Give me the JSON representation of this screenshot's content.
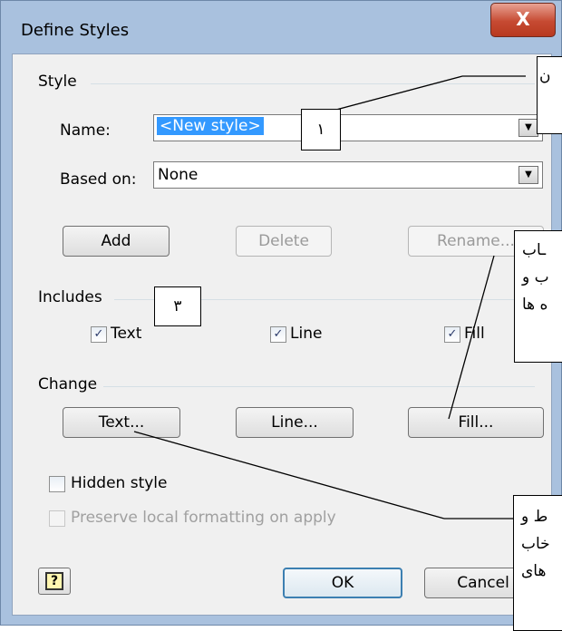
{
  "window": {
    "title": "Define Styles",
    "close_glyph": "X"
  },
  "style_group": {
    "label": "Style",
    "name_label": "Name:",
    "name_value": "<New style>",
    "based_on_label": "Based on:",
    "based_on_value": "None"
  },
  "buttons": {
    "add": "Add",
    "delete": "Delete",
    "rename": "Rename...",
    "text": "Text...",
    "line": "Line...",
    "fill": "Fill...",
    "ok": "OK",
    "cancel": "Cancel"
  },
  "includes_group": {
    "label": "Includes",
    "text": "Text",
    "line": "Line",
    "fill": "Fill"
  },
  "change_group": {
    "label": "Change"
  },
  "options": {
    "hidden_style": "Hidden style",
    "preserve_formatting": "Preserve local formatting on apply"
  },
  "help_glyph": "?",
  "annotations": {
    "label_1": "١",
    "label_3": "٣",
    "callout_top_line1": "ن",
    "callout_fill_line1": "ـاب",
    "callout_fill_line2": "ب و",
    "callout_fill_line3": "ه ها",
    "callout_text_line1": "ط و",
    "callout_text_line2": "خاب",
    "callout_text_line3": "های"
  }
}
